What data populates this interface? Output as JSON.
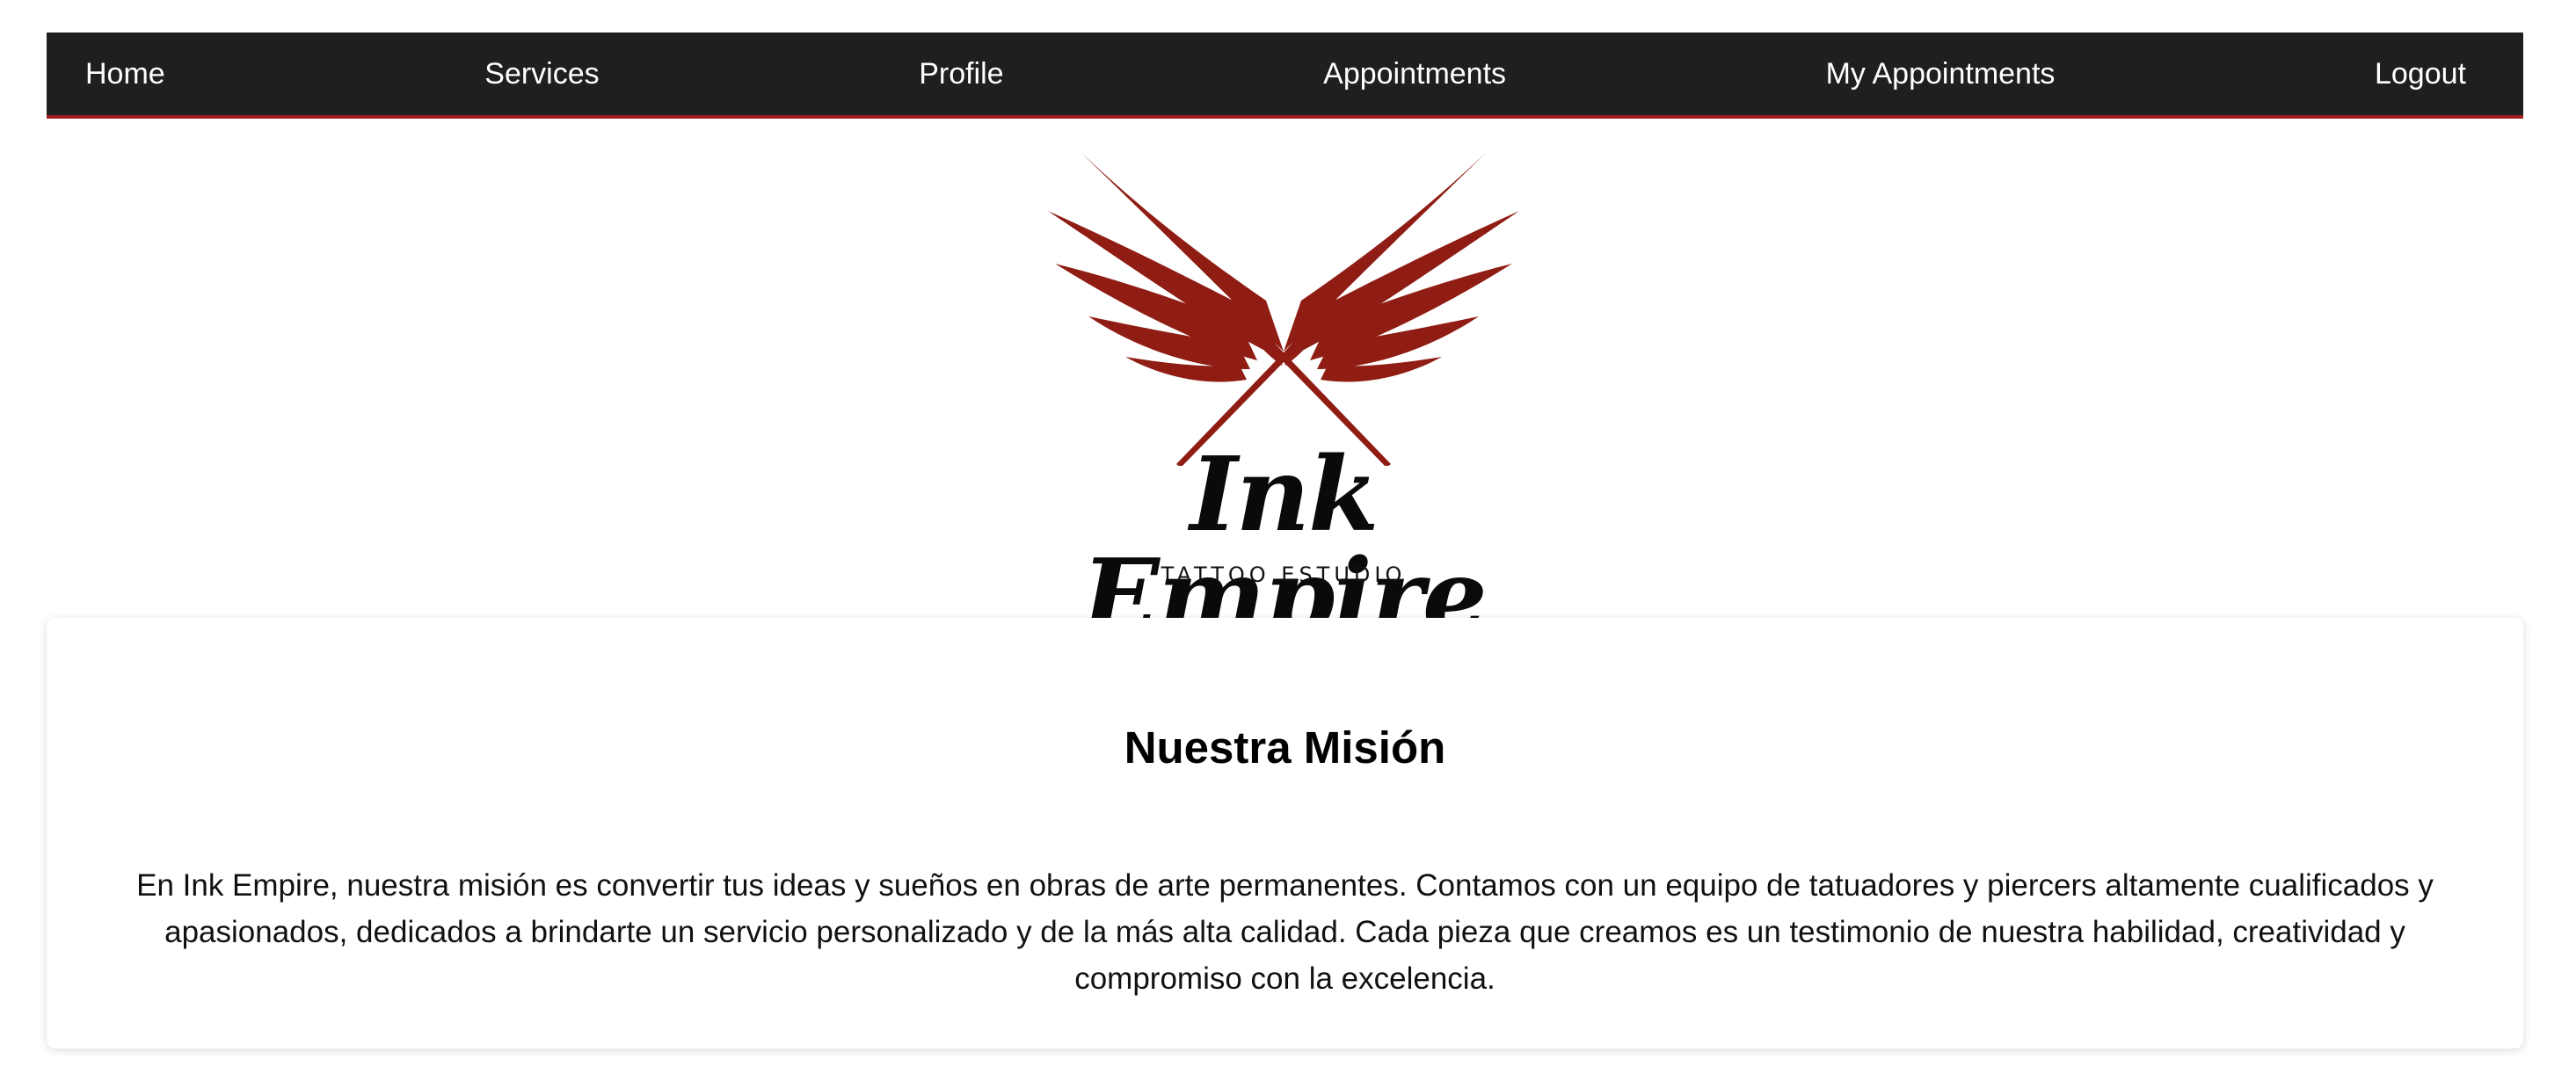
{
  "nav": {
    "items": [
      {
        "label": "Home"
      },
      {
        "label": "Services"
      },
      {
        "label": "Profile"
      },
      {
        "label": "Appointments"
      },
      {
        "label": "My Appointments"
      },
      {
        "label": "Logout"
      }
    ]
  },
  "brand": {
    "name": "Ink Empire",
    "tagline": "TATTOO ESTUDIO",
    "logo_icon": "winged-needles-icon",
    "accent_color": "#8f1d14"
  },
  "mission": {
    "title": "Nuestra Misión",
    "text": "En Ink Empire, nuestra misión es convertir tus ideas y sueños en obras de arte permanentes. Contamos con un equipo de tatuadores y piercers altamente cualificados y apasionados, dedicados a brindarte un servicio personalizado y de la más alta calidad. Cada pieza que creamos es un testimonio de nuestra habilidad, creatividad y compromiso con la excelencia."
  },
  "colors": {
    "navbar_bg": "#1f1f1f",
    "navbar_border": "#a11d1d",
    "text": "#111111"
  }
}
